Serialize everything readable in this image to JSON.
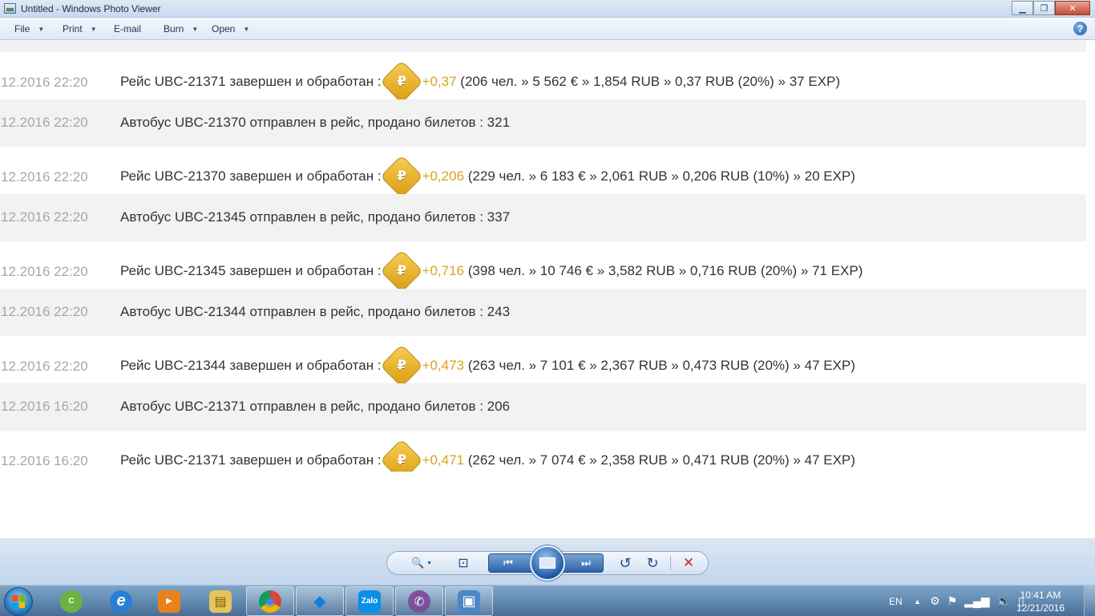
{
  "window": {
    "title": "Untitled - Windows Photo Viewer",
    "minimize": "▁",
    "maximize": "❐",
    "close": "✕"
  },
  "menu": {
    "items": [
      {
        "label": "File",
        "has_dropdown": true
      },
      {
        "label": "Print",
        "has_dropdown": true
      },
      {
        "label": "E-mail",
        "has_dropdown": false
      },
      {
        "label": "Burn",
        "has_dropdown": true
      },
      {
        "label": "Open",
        "has_dropdown": true
      }
    ],
    "help": "?"
  },
  "feed": {
    "currency_symbol": "₽",
    "rows": [
      {
        "time": "12.2016 22:20",
        "text": "Рейс UBC-21371 завершен и обработан :",
        "gain": "+0,37",
        "detail": "(206 чел. » 5 562 € » 1,854 RUB » 0,37 RUB (20%) » 37 EXP)"
      },
      {
        "time": "12.2016 22:20",
        "text": "Автобус UBC-21370 отправлен в рейс, продано билетов : 321"
      },
      {
        "time": "12.2016 22:20",
        "text": "Рейс UBC-21370 завершен и обработан :",
        "gain": "+0,206",
        "detail": "(229 чел. » 6 183 € » 2,061 RUB » 0,206 RUB (10%) » 20 EXP)"
      },
      {
        "time": "12.2016 22:20",
        "text": "Автобус UBC-21345 отправлен в рейс, продано билетов : 337"
      },
      {
        "time": "12.2016 22:20",
        "text": "Рейс UBC-21345 завершен и обработан :",
        "gain": "+0,716",
        "detail": "(398 чел. » 10 746 € » 3,582 RUB » 0,716 RUB (20%) » 71 EXP)"
      },
      {
        "time": "12.2016 22:20",
        "text": "Автобус UBC-21344 отправлен в рейс, продано билетов : 243"
      },
      {
        "time": "12.2016 22:20",
        "text": "Рейс UBC-21344 завершен и обработан :",
        "gain": "+0,473",
        "detail": "(263 чел. » 7 101 € » 2,367 RUB » 0,473 RUB (20%) » 47 EXP)"
      },
      {
        "time": "12.2016 16:20",
        "text": "Автобус UBC-21371 отправлен в рейс, продано билетов : 206"
      },
      {
        "time": "12.2016 16:20",
        "text": "Рейс UBC-21371 завершен и обработан :",
        "gain": "+0,471",
        "detail": "(262 чел. » 7 074 € » 2,358 RUB » 0,471 RUB (20%) » 47 EXP)"
      }
    ]
  },
  "controls": {
    "zoom": "🔍",
    "fit": "⊡",
    "previous": "⏮",
    "next": "⏭",
    "rotate_ccw": "↺",
    "rotate_cw": "↻",
    "delete": "✕"
  },
  "taskbar": {
    "apps": [
      {
        "name": "coccoc",
        "glyph": "C",
        "color": "#6cb33f"
      },
      {
        "name": "internet-explorer",
        "glyph": "e",
        "color": "#2a7fd4"
      },
      {
        "name": "media-player",
        "glyph": "▶",
        "color": "#e8821e"
      },
      {
        "name": "file-explorer",
        "glyph": "▤",
        "color": "#e8c35a"
      },
      {
        "name": "chrome",
        "glyph": "◉",
        "color": "#db4437"
      },
      {
        "name": "dropbox",
        "glyph": "◆",
        "color": "#1081de"
      },
      {
        "name": "zalo",
        "glyph": "Zalo",
        "color": "#0a8fe8"
      },
      {
        "name": "viber",
        "glyph": "✆",
        "color": "#7b519d"
      },
      {
        "name": "photo-viewer",
        "glyph": "▣",
        "color": "#4b87c6"
      }
    ],
    "language": "EN",
    "time": "10:41 AM",
    "date": "12/21/2016"
  }
}
